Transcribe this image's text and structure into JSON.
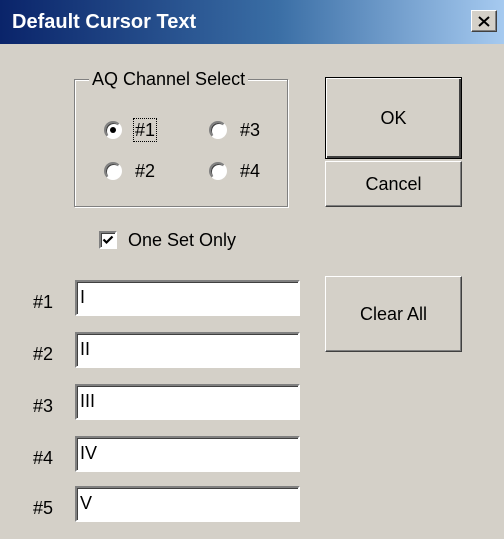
{
  "window": {
    "title": "Default Cursor Text",
    "close_icon": "close-icon"
  },
  "channel_group": {
    "legend": "AQ Channel Select",
    "selected": "#1",
    "options": [
      {
        "label": "#1",
        "checked": true
      },
      {
        "label": "#3",
        "checked": false
      },
      {
        "label": "#2",
        "checked": false
      },
      {
        "label": "#4",
        "checked": false
      }
    ]
  },
  "buttons": {
    "ok_label": "OK",
    "cancel_label": "Cancel",
    "clear_all_label": "Clear All"
  },
  "one_set_only": {
    "label": "One Set Only",
    "checked": true
  },
  "fields": [
    {
      "label": "#1",
      "value": "I"
    },
    {
      "label": "#2",
      "value": "II"
    },
    {
      "label": "#3",
      "value": "III"
    },
    {
      "label": "#4",
      "value": "IV"
    },
    {
      "label": "#5",
      "value": "V"
    }
  ],
  "colors": {
    "dialog_bg": "#d4d0c8",
    "titlebar_start": "#0a246a",
    "titlebar_end": "#a6caf0",
    "title_text": "#ffffff"
  }
}
